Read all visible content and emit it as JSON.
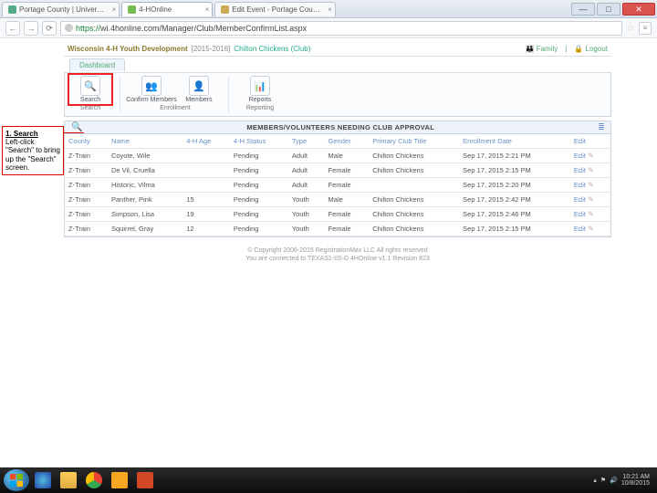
{
  "browser": {
    "tabs": [
      {
        "label": "Portage County | Univer…"
      },
      {
        "label": "4-HOnline"
      },
      {
        "label": "Edit Event - Portage Cou…"
      }
    ],
    "window_close": "✕",
    "window_min": "—",
    "window_max": "□",
    "nav_back": "←",
    "nav_fwd": "→",
    "reload": "⟳",
    "url_prefix": "https://",
    "url_rest": "wi.4honline.com/Manager/Club/MemberConfirmList.aspx",
    "star": "☆",
    "menu": "≡"
  },
  "header": {
    "org": "Wisconsin 4-H Youth Development",
    "year": "[2015-2016]",
    "club": "Chilton Chickens (Club)",
    "family": "Family",
    "logout": "Logout"
  },
  "dashboard_tab": "Dashboard",
  "ribbon": {
    "search": {
      "label": "Search",
      "icon": "🔍"
    },
    "confirm": {
      "label": "Confirm\nMembers",
      "icon": "👥"
    },
    "members": {
      "label": "Members",
      "icon": "👤"
    },
    "reports": {
      "label": "Reports",
      "icon": "📊"
    },
    "group_enroll": "Enrollment",
    "group_report": "Reporting"
  },
  "callout": {
    "title": "1. Search",
    "body": "Left-click \"Search\" to bring up the \"Search\" screen."
  },
  "panel": {
    "title": "MEMBERS/VOLUNTEERS NEEDING CLUB APPROVAL",
    "mag": "🔍",
    "lines": "≣",
    "cols": {
      "county": "County",
      "name": "Name",
      "age": "4-H Age",
      "status": "4-H Status",
      "type": "Type",
      "gender": "Gender",
      "club": "Primary Club Title",
      "enroll": "Enrollment Date",
      "edit": "Edit"
    },
    "edit_label": "Edit",
    "rows": [
      {
        "county": "Z-Train",
        "name": "Coyote, Wile",
        "age": "",
        "status": "Pending",
        "type": "Adult",
        "gender": "Male",
        "club": "Chilton Chickens",
        "enroll": "Sep 17, 2015 2:21 PM"
      },
      {
        "county": "Z-Train",
        "name": "De Vil, Cruella",
        "age": "",
        "status": "Pending",
        "type": "Adult",
        "gender": "Female",
        "club": "Chilton Chickens",
        "enroll": "Sep 17, 2015 2:15 PM"
      },
      {
        "county": "Z-Train",
        "name": "Historic, Vilma",
        "age": "",
        "status": "Pending",
        "type": "Adult",
        "gender": "Female",
        "club": "",
        "enroll": "Sep 17, 2015 2:20 PM"
      },
      {
        "county": "Z-Train",
        "name": "Panther, Pink",
        "age": "15",
        "status": "Pending",
        "type": "Youth",
        "gender": "Male",
        "club": "Chilton Chickens",
        "enroll": "Sep 17, 2015 2:42 PM"
      },
      {
        "county": "Z-Train",
        "name": "Simpson, Lisa",
        "age": "19",
        "status": "Pending",
        "type": "Youth",
        "gender": "Female",
        "club": "Chilton Chickens",
        "enroll": "Sep 17, 2015 2:46 PM"
      },
      {
        "county": "Z-Train",
        "name": "Squirrel, Gray",
        "age": "12",
        "status": "Pending",
        "type": "Youth",
        "gender": "Female",
        "club": "Chilton Chickens",
        "enroll": "Sep 17, 2015 2:15 PM"
      }
    ]
  },
  "footer": {
    "line1": "© Copyright 2006-2015 RegistrationMax LLC All rights reserved",
    "line2": "You are connected to TEXAS1-IIS-D  4HOnline v1.1 Revision 823"
  },
  "taskbar": {
    "time": "10:21 AM",
    "date": "10/8/2015"
  }
}
